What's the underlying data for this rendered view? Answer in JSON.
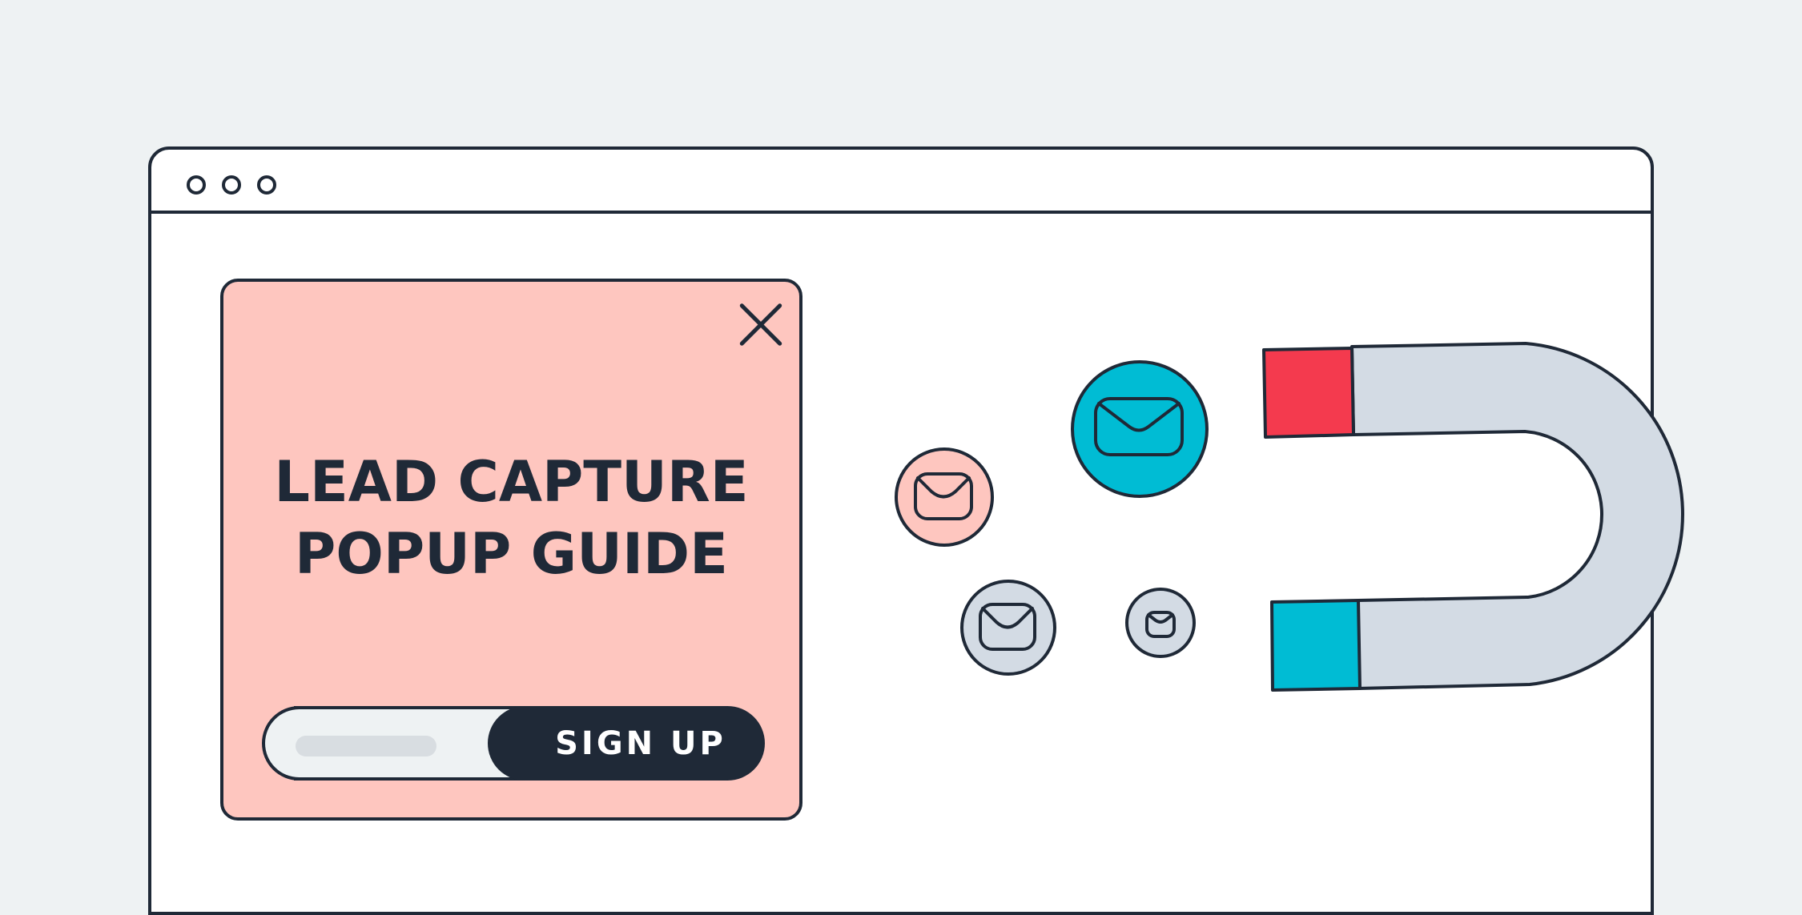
{
  "popup": {
    "headline_line1": "LEAD CAPTURE",
    "headline_line2": "POPUP GUIDE",
    "signup_label": "SIGN UP"
  },
  "colors": {
    "background": "#eef2f3",
    "outline": "#1f2937",
    "popup_fill": "#fec6bf",
    "magnet_red": "#f43a4e",
    "magnet_cyan": "#00bcd4",
    "magnet_body": "#d3dbe4"
  },
  "icons": [
    "envelope-icon",
    "magnet-icon",
    "close-icon"
  ]
}
